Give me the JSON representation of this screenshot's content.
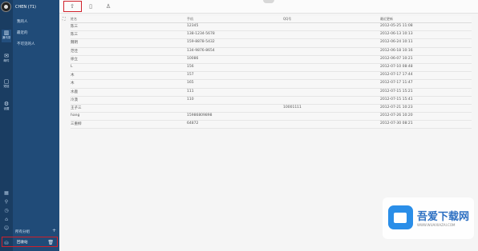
{
  "account": "CHEN (71)",
  "rail": [
    "通讯录",
    "邮件",
    "短信",
    "设置"
  ],
  "folders": [
    "我的人",
    "最近的",
    "不可见的人"
  ],
  "sidebar_footer": {
    "group_label": "所有分组",
    "backup_label": "回收站"
  },
  "toolbar": {
    "export_icon": "upload-icon",
    "delete_icon": "trash-icon",
    "merge_icon": "person-icon"
  },
  "table": {
    "headers": [
      "姓名",
      "手机",
      "QQ号",
      "最近更新"
    ],
    "rows": [
      [
        "陈三",
        "12345",
        "",
        "2012-05-25 11:08"
      ],
      [
        "陈三",
        "138-1234-5678",
        "",
        "2012-06-13 10:13"
      ],
      [
        "魏明",
        "159-8878-5432",
        "",
        "2012-06-24 10:11"
      ],
      [
        "范佳",
        "134-9876-8654",
        "",
        "2012-06-18 10:16"
      ],
      [
        "徐立",
        "10086",
        "",
        "2012-06-07 10:21"
      ],
      [
        "L",
        "156",
        "",
        "2012-07-10 08:48"
      ],
      [
        "木",
        "157",
        "",
        "2012-07-17 17:44"
      ],
      [
        "木",
        "165",
        "",
        "2012-07-17 11:47"
      ],
      [
        "水鹿",
        "111",
        "",
        "2012-07-15 15:21"
      ],
      [
        "冷漠",
        "110",
        "",
        "2012-07-15 15:41"
      ],
      [
        "王子三",
        "",
        "10001111",
        "2012-07-21 10:23"
      ],
      [
        "hang",
        "15986809898",
        "",
        "2012-07-26 10:20"
      ],
      [
        "三重柳",
        "64872",
        "",
        "2012-07-30 08:21"
      ]
    ]
  },
  "watermark": {
    "title": "吾爱下载网",
    "url": "WWW.WUAIXIAZAI.COM"
  }
}
